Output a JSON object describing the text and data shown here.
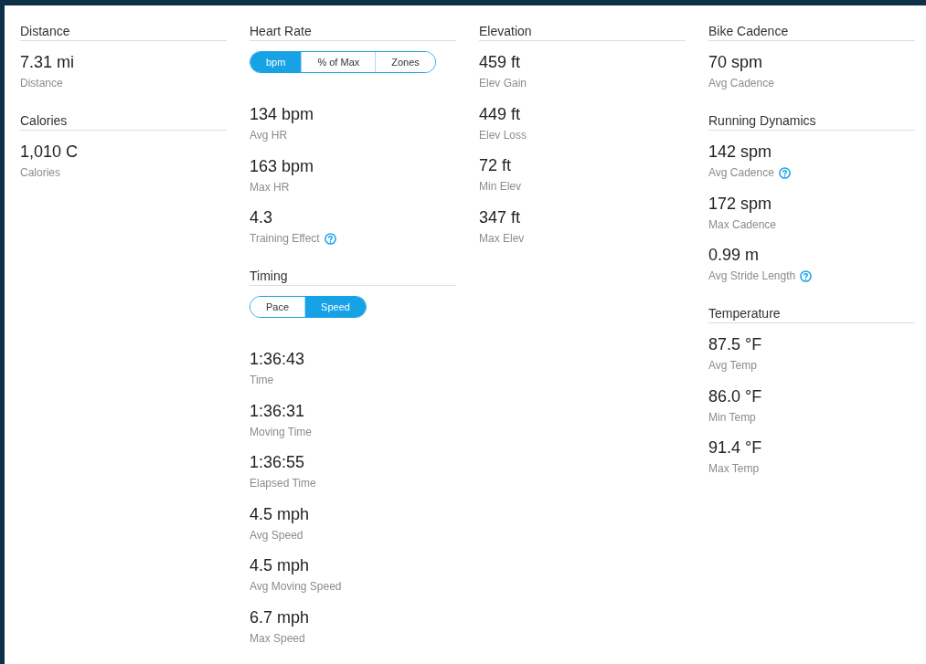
{
  "columns": [
    {
      "sections": [
        {
          "title": "Distance",
          "metrics": [
            {
              "value": "7.31 mi",
              "label": "Distance"
            }
          ]
        },
        {
          "title": "Calories",
          "metrics": [
            {
              "value": "1,010 C",
              "label": "Calories"
            }
          ]
        }
      ]
    },
    {
      "sections": [
        {
          "title": "Heart Rate",
          "toggle": [
            {
              "label": "bpm",
              "selected": true
            },
            {
              "label": "% of Max",
              "selected": false
            },
            {
              "label": "Zones",
              "selected": false
            }
          ],
          "metrics": [
            {
              "value": "134 bpm",
              "label": "Avg HR"
            },
            {
              "value": "163 bpm",
              "label": "Max HR"
            },
            {
              "value": "4.3",
              "label": "Training Effect",
              "info": true
            }
          ]
        },
        {
          "title": "Timing",
          "toggle": [
            {
              "label": "Pace",
              "selected": false
            },
            {
              "label": "Speed",
              "selected": true
            }
          ],
          "metrics": [
            {
              "value": "1:36:43",
              "label": "Time"
            },
            {
              "value": "1:36:31",
              "label": "Moving Time"
            },
            {
              "value": "1:36:55",
              "label": "Elapsed Time"
            },
            {
              "value": "4.5 mph",
              "label": "Avg Speed"
            },
            {
              "value": "4.5 mph",
              "label": "Avg Moving Speed"
            },
            {
              "value": "6.7 mph",
              "label": "Max Speed"
            }
          ]
        }
      ]
    },
    {
      "sections": [
        {
          "title": "Elevation",
          "metrics": [
            {
              "value": "459 ft",
              "label": "Elev Gain"
            },
            {
              "value": "449 ft",
              "label": "Elev Loss"
            },
            {
              "value": "72 ft",
              "label": "Min Elev"
            },
            {
              "value": "347 ft",
              "label": "Max Elev"
            }
          ]
        }
      ]
    },
    {
      "sections": [
        {
          "title": "Bike Cadence",
          "metrics": [
            {
              "value": "70 spm",
              "label": "Avg Cadence"
            }
          ]
        },
        {
          "title": "Running Dynamics",
          "metrics": [
            {
              "value": "142 spm",
              "label": "Avg Cadence",
              "info": true
            },
            {
              "value": "172 spm",
              "label": "Max Cadence"
            },
            {
              "value": "0.99 m",
              "label": "Avg Stride Length",
              "info": true
            }
          ]
        },
        {
          "title": "Temperature",
          "metrics": [
            {
              "value": "87.5 °F",
              "label": "Avg Temp"
            },
            {
              "value": "86.0 °F",
              "label": "Min Temp"
            },
            {
              "value": "91.4 °F",
              "label": "Max Temp"
            }
          ]
        }
      ]
    }
  ]
}
